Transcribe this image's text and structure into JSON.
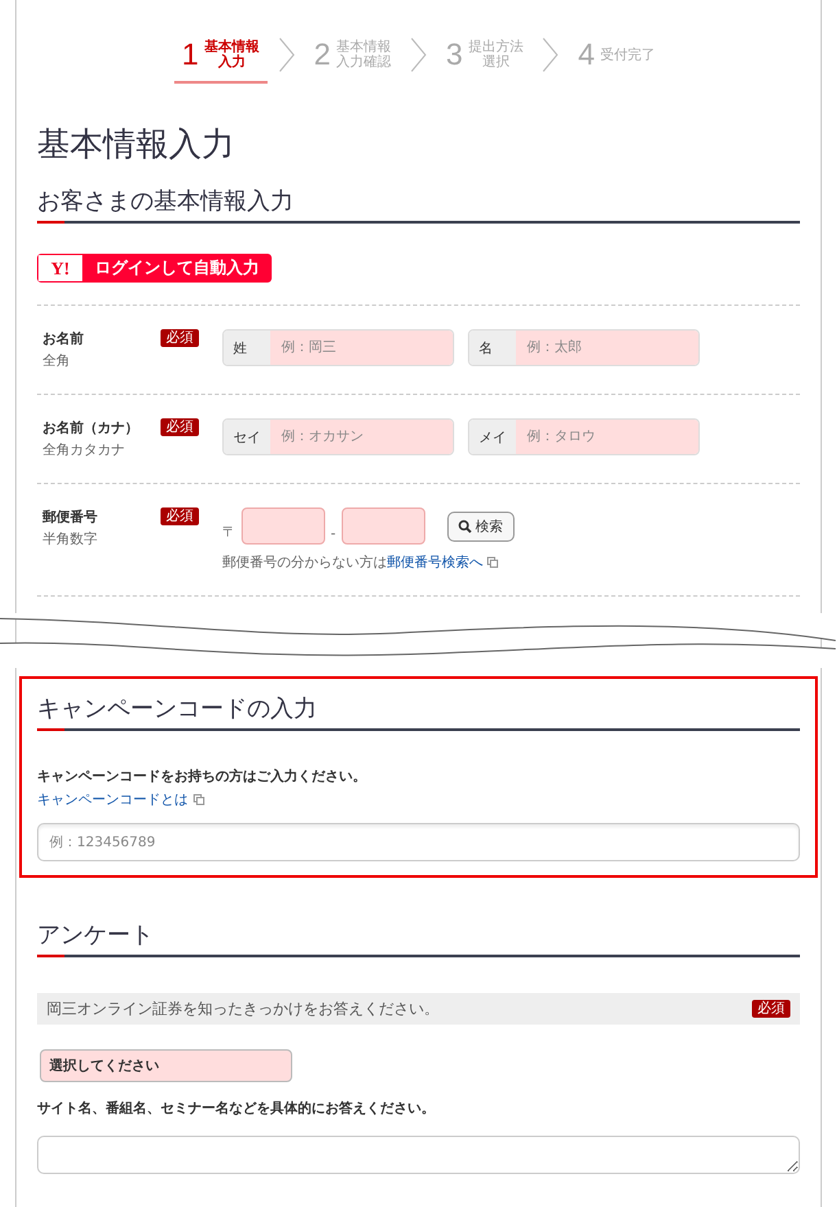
{
  "steps": [
    {
      "number": "1",
      "lines": [
        "基本情報",
        "入力"
      ],
      "selected": true
    },
    {
      "number": "2",
      "lines": [
        "基本情報",
        "入力確認"
      ],
      "selected": false
    },
    {
      "number": "3",
      "lines": [
        "提出方法",
        "選択"
      ],
      "selected": false
    },
    {
      "number": "4",
      "lines": [
        "受付完了"
      ],
      "selected": false
    }
  ],
  "page_title": "基本情報入力",
  "basic_section": {
    "heading": "お客さまの基本情報入力",
    "login_button": {
      "logo": "Y!",
      "label": "ログインして自動入力"
    },
    "rows": [
      {
        "kind": "pair",
        "label": "お名前",
        "hint": "全角",
        "badge": "必須",
        "fields": [
          {
            "prefix": "姓",
            "placeholder": "例：岡三"
          },
          {
            "prefix": "名",
            "placeholder": "例：太郎"
          }
        ]
      },
      {
        "kind": "pair",
        "label": "お名前（カナ）",
        "hint": "全角カタカナ",
        "badge": "必須",
        "fields": [
          {
            "prefix": "セイ",
            "placeholder": "例：オカサン"
          },
          {
            "prefix": "メイ",
            "placeholder": "例：タロウ"
          }
        ]
      },
      {
        "kind": "postal",
        "label": "郵便番号",
        "hint": "半角数字",
        "badge": "必須",
        "mark": "〒",
        "separator": "-",
        "search_button": "検索",
        "note": "郵便番号の分からない方は",
        "note_link": "郵便番号検索へ"
      }
    ]
  },
  "campaign_section": {
    "heading": "キャンペーンコードの入力",
    "instruction": "キャンペーンコードをお持ちの方はご入力ください。",
    "link": "キャンペーンコードとは",
    "placeholder": "例：123456789"
  },
  "survey_section": {
    "heading": "アンケート",
    "question": "岡三オンライン証券を知ったきっかけをお答えください。",
    "badge": "必須",
    "select": "選択してください",
    "detail_label": "サイト名、番組名、セミナー名などを具体的にお答えください。"
  }
}
